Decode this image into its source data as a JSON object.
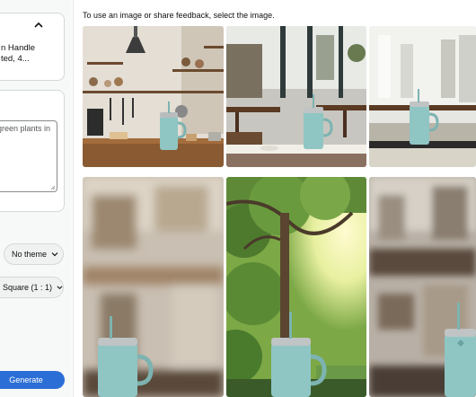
{
  "product_card": {
    "text_line1": "n Handle",
    "text_line2": "ted, 4..."
  },
  "prompt": {
    "value": "green plants in"
  },
  "theme_select": {
    "selected": "No theme"
  },
  "aspect_select": {
    "selected": "Square (1 : 1)"
  },
  "generate_label": "Generate",
  "gallery": {
    "instruction": "To use an image or share feedback, select the image.",
    "images": [
      {
        "scene": "kitchen shelves"
      },
      {
        "scene": "restaurant interior"
      },
      {
        "scene": "bright cafe"
      },
      {
        "scene": "blurred interior"
      },
      {
        "scene": "trees with sunlight"
      },
      {
        "scene": "blurred shop"
      }
    ]
  },
  "colors": {
    "accent": "#2b6ed6",
    "tumbler": "#8fc6c4"
  }
}
